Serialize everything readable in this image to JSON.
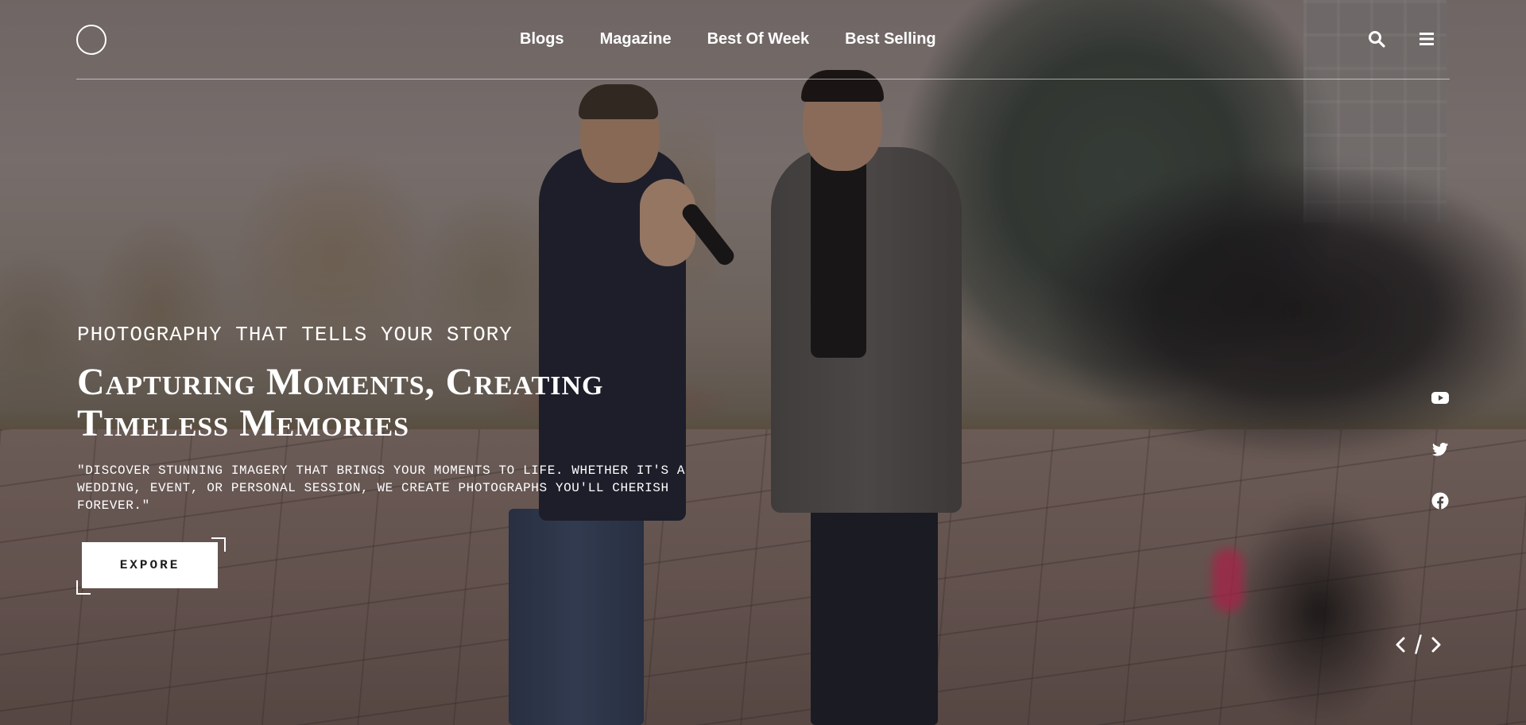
{
  "header": {
    "nav": [
      {
        "label": "Blogs"
      },
      {
        "label": "Magazine"
      },
      {
        "label": "Best Of Week"
      },
      {
        "label": "Best Selling"
      }
    ],
    "icons": {
      "logo": "circle-logo-icon",
      "search": "search-icon",
      "menu": "hamburger-menu-icon"
    }
  },
  "hero": {
    "eyebrow": "PHOTOGRAPHY THAT TELLS YOUR STORY",
    "headline": "Capturing Moments, Creating Timeless Memories",
    "description": "\"Discover stunning imagery that brings your moments to life. Whether it's a wedding, event, or personal session, we create photographs you'll cherish forever.\"",
    "button_label": "EXPORE"
  },
  "social": [
    {
      "icon": "youtube-icon"
    },
    {
      "icon": "twitter-icon"
    },
    {
      "icon": "facebook-icon"
    }
  ],
  "slider": {
    "prev_icon": "chevron-left-icon",
    "separator": "/",
    "next_icon": "chevron-right-icon"
  },
  "colors": {
    "text": "#ffffff",
    "button_bg": "#ffffff",
    "button_text": "#1d1d1d"
  }
}
